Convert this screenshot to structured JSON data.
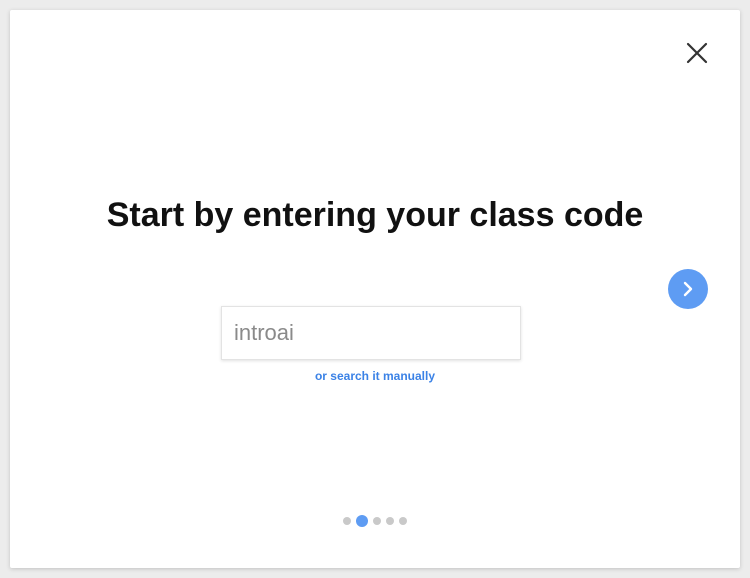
{
  "modal": {
    "title": "Start by entering your class code",
    "close_icon": "close-icon",
    "next_icon": "chevron-right-icon",
    "class_code_input": {
      "value": "introai",
      "placeholder": ""
    },
    "search_link": "or search it manually",
    "pagination": {
      "total": 5,
      "active_index": 1
    }
  },
  "colors": {
    "accent": "#5e9cf3",
    "link": "#3b82e6",
    "title": "#111111",
    "dot_inactive": "#c9c9c9"
  }
}
